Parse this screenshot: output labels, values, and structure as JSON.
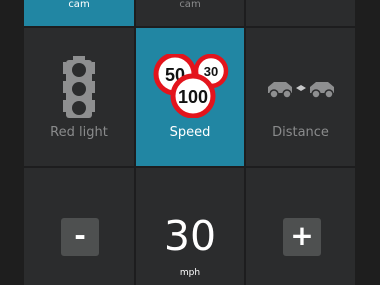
{
  "top_tabs": [
    {
      "label": "cam",
      "active": true
    },
    {
      "label": "cam",
      "active": false
    },
    {
      "label": "",
      "active": false
    }
  ],
  "modes": [
    {
      "label": "Red light",
      "icon": "traffic-light-icon",
      "active": false
    },
    {
      "label": "Speed",
      "icon": "speed-limit-signs-icon",
      "active": true,
      "signs": [
        "50",
        "30",
        "100"
      ]
    },
    {
      "label": "Distance",
      "icon": "car-distance-icon",
      "active": false
    }
  ],
  "speed": {
    "value": "30",
    "unit": "mph",
    "decrement_label": "-",
    "increment_label": "+"
  },
  "colors": {
    "active": "#2186a3",
    "panel": "#2b2c2d",
    "button": "#4e5050",
    "sign_border": "#e3141c"
  }
}
